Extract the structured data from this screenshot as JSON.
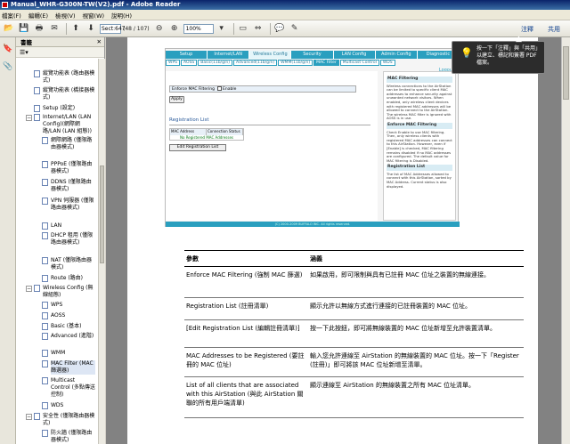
{
  "window": {
    "title": "Manual_WHR-G300N-TW(V2).pdf - Adobe Reader"
  },
  "menu": [
    "檔案(F)",
    "編輯(E)",
    "檢視(V)",
    "視窗(W)",
    "說明(H)"
  ],
  "toolbar": {
    "page_value": "Sect:647",
    "page_count": "(48 / 107)",
    "zoom_value": "100%",
    "comment_label": "注釋",
    "share_label": "共用"
  },
  "bookmarks": {
    "title": "書籤",
    "items": [
      {
        "label": "縱覽功能表 (路由器模式)"
      },
      {
        "label": "縱覽功能表 (橋接器模式)"
      },
      {
        "label": "Setup (設定)"
      },
      {
        "label": "Internet/LAN (LAN Config)(網際網路/LAN (LAN 組態))"
      },
      {
        "label": "網際網路 (僅限路由器模式)"
      },
      {
        "label": "PPPoE (僅限路由器模式)"
      },
      {
        "label": "DDNS (僅限路由器模式)"
      },
      {
        "label": "VPN 伺服器 (僅限路由器模式)"
      },
      {
        "label": "LAN"
      },
      {
        "label": "DHCP 租用 (僅限路由器模式)"
      },
      {
        "label": "NAT (僅限路由器模式)"
      },
      {
        "label": "Route (路由)"
      },
      {
        "label": "Wireless Config (無線組態)"
      },
      {
        "label": "WPS"
      },
      {
        "label": "AOSS"
      },
      {
        "label": "Basic (基本)"
      },
      {
        "label": "Advanced (進階)"
      },
      {
        "label": "WMM"
      },
      {
        "label": "MAC Filter (MAC 篩選器)"
      },
      {
        "label": "Multicast Control (多點傳送控制)"
      },
      {
        "label": "WDS"
      },
      {
        "label": "安全性 (僅限路由器模式)"
      },
      {
        "label": "防火牆 (僅限路由器模式)"
      }
    ]
  },
  "tooltip": {
    "text": "按一下「注釋」與「共用」以建立、標記和簽署 PDF 檔案。"
  },
  "shot": {
    "nav": [
      "Setup",
      "Internet/LAN",
      "Wireless Config",
      "Security",
      "LAN Config",
      "Admin Config",
      "Diagnostic"
    ],
    "subnav": [
      "WPS",
      "AOSS",
      "Basic(11b/g/n)",
      "Advanced(11b/g/n)",
      "WMM(11b/g/n)",
      "MAC Filter",
      "Multicast Control",
      "WDS"
    ],
    "logout": "Logout",
    "enforce_label": "Enforce MAC Filtering",
    "enable_label": "Enable",
    "apply_label": "Apply",
    "reg_list_title": "Registration List",
    "col_mac": "MAC Address",
    "col_status": "Connection Status",
    "no_reg": "No Registered MAC Addresses",
    "edit_btn": "Edit Registration List",
    "help_h1": "MAC Filtering",
    "help_p1": "Wireless connections to the AirStation can be limited to specific client MAC addresses to enhance security against unwanted network visitors. When enabled, only wireless client devices with registered MAC addresses will be allowed to connect to the AirStation. The wireless MAC filter is ignored with AOSS is in use.",
    "help_h2": "Enforce MAC Filtering",
    "help_p2": "Check Enable to use MAC filtering. Then, only wireless clients with registered MAC addresses can connect to this AirStation. However, even if [Enable] is checked, MAC filtering remains disabled if no MAC addresses are configured. The default value for MAC filtering is Disabled.",
    "help_h3": "Registration List",
    "help_p3": "The list of MAC Addresses allowed to connect with this AirStation, sorted by MAC Address. Current status is also displayed.",
    "footer": "(C) 2000-2009 BUFFALO INC. All rights reserved."
  },
  "table": {
    "header": {
      "param": "參數",
      "desc": "涵義"
    },
    "rows": [
      {
        "param": "Enforce MAC Filtering (強制 MAC 篩選)",
        "desc": "如果啟用，即可限制與具有已註冊 MAC 位址之裝置的無線連接。"
      },
      {
        "param": "Registration List (註冊清單)",
        "desc": "顯示允許以無線方式進行連接的已註冊裝置的 MAC 位址。"
      },
      {
        "param": "[Edit Registration List (編輯註冊清單)]",
        "desc": "按一下此按鈕，即可將無線裝置的 MAC 位址新增至允許裝置清單。"
      },
      {
        "param": "MAC Addresses to be Registered (要註冊的 MAC 位址)",
        "desc": "輸入您允許連線至 AirStation 的無線裝置的 MAC 位址。按一下「Register (註冊)」即可將該 MAC 位址新增至清單。"
      },
      {
        "param": "List of all clients that are associated with this AirStation (與此 AirStation 關聯的所有用戶端清單)",
        "desc": "顯示連線至 AirStation 的無線裝置之所有 MAC 位址清單。"
      }
    ]
  }
}
